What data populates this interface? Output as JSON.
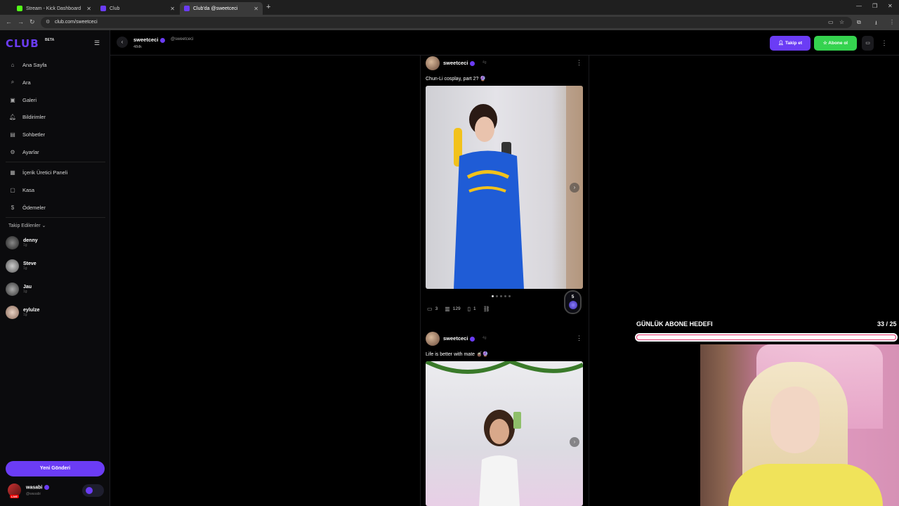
{
  "browser": {
    "tabs": [
      {
        "title": "Stream - Kick Dashboard",
        "favicon": "kick-icon",
        "color": "#53fc18",
        "active": false
      },
      {
        "title": "Club",
        "favicon": "club-icon",
        "color": "#6b3cf5",
        "active": false
      },
      {
        "title": "Club'da @sweetceci",
        "favicon": "club-icon",
        "color": "#6b3cf5",
        "active": true
      }
    ],
    "url": "club.com/sweetceci"
  },
  "sidebar": {
    "logo": "CLUB",
    "logo_badge": "BETA",
    "nav": [
      {
        "label": "Ana Sayfa",
        "icon": "home-icon"
      },
      {
        "label": "Ara",
        "icon": "search-icon"
      },
      {
        "label": "Galeri",
        "icon": "gallery-icon"
      },
      {
        "label": "Bildirimler",
        "icon": "bell-icon"
      },
      {
        "label": "Sohbetler",
        "icon": "chat-icon"
      },
      {
        "label": "Ayarlar",
        "icon": "gear-icon"
      }
    ],
    "nav2": [
      {
        "label": "İçerik Üretici Paneli",
        "icon": "dashboard-icon"
      },
      {
        "label": "Kasa",
        "icon": "vault-icon"
      },
      {
        "label": "Ödemeler",
        "icon": "payment-icon"
      }
    ],
    "following_title": "Takip Edilenler",
    "following": [
      {
        "name": "denny",
        "sub": "1g"
      },
      {
        "name": "Steve",
        "sub": "1g"
      },
      {
        "name": "Jau",
        "sub": "1g"
      },
      {
        "name": "eylulze",
        "sub": "1g"
      }
    ],
    "new_post_label": "Yeni Gönderi",
    "me": {
      "name": "wasabi",
      "handle": "@wasabi",
      "live": "LIVE"
    }
  },
  "header": {
    "name": "sweetceci",
    "handle": "@sweetceci",
    "count": "48dk",
    "follow_label": "Takip et",
    "subscribe_label": "Abone ol"
  },
  "posts": [
    {
      "author": "sweetceci",
      "time": "4g",
      "caption": "Chun-Li cosplay, part 2? 🔮",
      "comments": "3",
      "views": "129",
      "saves": "1",
      "tier_count": "5"
    },
    {
      "author": "sweetceci",
      "time": "4g",
      "caption": "Life is better with mate 🧉🔮"
    }
  ],
  "overlay": {
    "goal_title": "GÜNLÜK ABONE HEDEFI",
    "goal_count": "33 / 25",
    "bar_color": "#e8336d"
  }
}
